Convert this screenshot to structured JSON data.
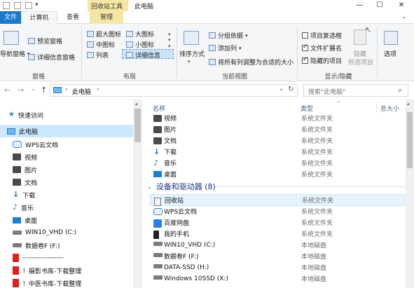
{
  "titlebar": {
    "context_group": "回收站工具",
    "title": "此电脑",
    "minimize": "—",
    "maximize": "☐",
    "close": "✕"
  },
  "tabs": {
    "file": "文件",
    "computer": "计算机",
    "view": "查看",
    "manage": "管理"
  },
  "ribbon": {
    "panes": {
      "nav_pane": "导航窗格",
      "preview_pane": "预览窗格",
      "details_pane": "详细信息窗格",
      "label": "窗格"
    },
    "layout": {
      "xl_icons": "超大图标",
      "l_icons": "大图标",
      "m_icons": "中图标",
      "s_icons": "小图标",
      "list": "列表",
      "details": "详细信息",
      "label": "布局"
    },
    "current_view": {
      "sort": "排序方式",
      "group_by": "分组依据",
      "add_column": "添加列",
      "fit_columns": "将所有列调整为合适的大小",
      "label": "当前视图"
    },
    "show_hide": {
      "item_checkboxes": "项目复选框",
      "file_extensions": "文件扩展名",
      "hidden_items": "隐藏的项目",
      "hide_selected_1": "隐藏",
      "hide_selected_2": "所选项目",
      "label": "显示/隐藏",
      "item_checkboxes_checked": false,
      "file_extensions_checked": true,
      "hidden_items_checked": true
    },
    "options": "选项"
  },
  "address": {
    "back": "←",
    "forward": "→",
    "recent": "⌄",
    "up": "↑",
    "sep": "›",
    "path": "此电脑",
    "path_arrow": "›",
    "dropdown": "⌄",
    "refresh": "↻",
    "search_placeholder": "搜索\"此电脑\"",
    "search_icon": "⌕"
  },
  "nav": {
    "quick_access": "快速访问",
    "this_pc": "此电脑",
    "items": [
      {
        "label": "WPS云文档",
        "icon": "cloud-icon"
      },
      {
        "label": "视频",
        "icon": "video-folder-icon"
      },
      {
        "label": "图片",
        "icon": "pictures-folder-icon"
      },
      {
        "label": "文档",
        "icon": "documents-folder-icon"
      },
      {
        "label": "下载",
        "icon": "download-icon"
      },
      {
        "label": "音乐",
        "icon": "music-icon"
      },
      {
        "label": "桌面",
        "icon": "desktop-icon"
      },
      {
        "label": "WIN10_VHD (C:)",
        "icon": "drive-icon"
      },
      {
        "label": "数据卷F (F:)",
        "icon": "drive-icon"
      },
      {
        "label": "------------------",
        "icon": "red-folder-icon"
      },
      {
        "label": "！摄影书库-下载整理",
        "icon": "red-folder-icon"
      },
      {
        "label": "！中医书库-下载整理",
        "icon": "red-folder-icon"
      }
    ]
  },
  "columns": {
    "name": "名称",
    "type": "类型",
    "total_size": "总大小",
    "sort_arrow": "^"
  },
  "folders": [
    {
      "name": "视频",
      "type": "系统文件夹"
    },
    {
      "name": "图片",
      "type": "系统文件夹"
    },
    {
      "name": "文档",
      "type": "系统文件夹"
    },
    {
      "name": "下载",
      "type": "系统文件夹"
    },
    {
      "name": "音乐",
      "type": "系统文件夹"
    },
    {
      "name": "桌面",
      "type": "系统文件夹"
    }
  ],
  "devices_group": "设备和驱动器 (8)",
  "devices": [
    {
      "name": "回收站",
      "type": "系统文件夹"
    },
    {
      "name": "WPS云文档",
      "type": "系统文件夹"
    },
    {
      "name": "百度网盘",
      "type": "系统文件夹"
    },
    {
      "name": "我的手机",
      "type": "系统文件夹"
    },
    {
      "name": "WIN10_VHD (C:)",
      "type": "本地磁盘"
    },
    {
      "name": "数据卷F (F:)",
      "type": "本地磁盘"
    },
    {
      "name": "DATA-SSD (H:)",
      "type": "本地磁盘"
    },
    {
      "name": "Windows 10SSD (X:)",
      "type": "本地磁盘"
    }
  ]
}
